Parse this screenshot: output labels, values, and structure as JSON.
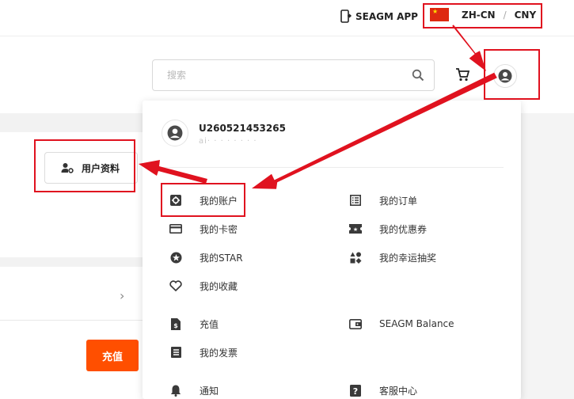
{
  "topbar": {
    "app_label": "SEAGM APP",
    "locale_lang": "ZH-CN",
    "locale_sep": "/",
    "locale_currency": "CNY"
  },
  "search": {
    "placeholder": "搜索"
  },
  "left": {
    "profile_label": "用户资料",
    "recharge_label": "充值"
  },
  "account_menu": {
    "username": "U260521453265",
    "email_masked": "ai· · · · · · · ·",
    "items": [
      {
        "label": "我的账户",
        "icon": "gear-icon"
      },
      {
        "label": "我的订单",
        "icon": "list-icon"
      },
      {
        "label": "我的卡密",
        "icon": "card-icon"
      },
      {
        "label": "我的优惠券",
        "icon": "coupon-icon"
      },
      {
        "label": "我的STAR",
        "icon": "star-icon"
      },
      {
        "label": "我的幸运抽奖",
        "icon": "lucky-draw-icon"
      },
      {
        "label": "我的收藏",
        "icon": "heart-icon"
      },
      {
        "label": "充值",
        "icon": "dollar-doc-icon"
      },
      {
        "label": "SEAGM Balance",
        "icon": "wallet-icon"
      },
      {
        "label": "我的发票",
        "icon": "invoice-icon"
      },
      {
        "label": "通知",
        "icon": "bell-icon"
      },
      {
        "label": "客服中心",
        "icon": "help-icon"
      }
    ]
  },
  "colors": {
    "accent": "#ff4f00",
    "annotation": "#e0121f",
    "icon": "#3a3a3a"
  }
}
